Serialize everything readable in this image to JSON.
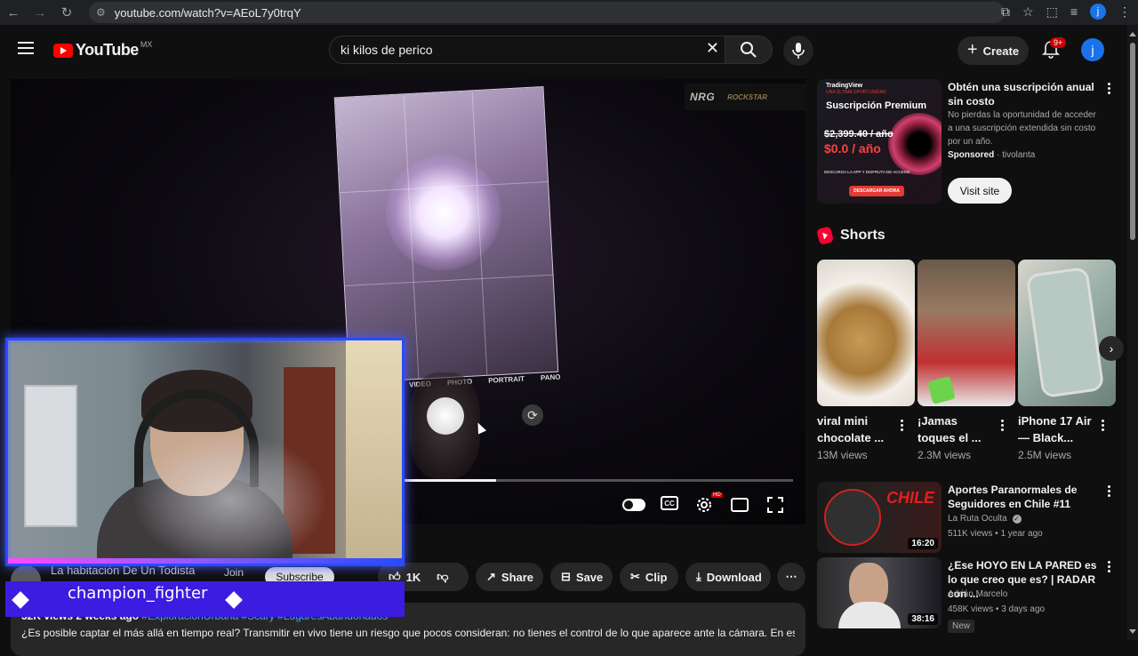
{
  "browser": {
    "url": "youtube.com/watch?v=AEoL7y0trqY",
    "profile_initial": "j"
  },
  "header": {
    "logo_text": "YouTube",
    "region": "MX",
    "search_value": "ki kilos de perico",
    "create_label": "Create",
    "notification_badge": "9+",
    "avatar_initial": "j"
  },
  "player": {
    "brand_logos": [
      "NRG",
      "ROCKSTAR"
    ],
    "camera_modes": [
      "VIDEO",
      "PHOTO",
      "PORTRAIT",
      "PANO"
    ],
    "hd_badge": "HD",
    "cc_label": "CC",
    "progress_fraction": 0.24
  },
  "stream_overlay": {
    "username": "champion_fighter"
  },
  "channel": {
    "name": "La habitación De Un Todista",
    "join_label": "Join",
    "subscribe_label": "Subscribe"
  },
  "actions": {
    "like_count": "1K",
    "share_label": "Share",
    "save_label": "Save",
    "clip_label": "Clip",
    "download_label": "Download"
  },
  "description": {
    "meta": "32K views  2 weeks ago",
    "tags": "#ExploracionUrbana #Scary #LugaresAbandonados",
    "text": "¿Es posible captar el más allá en tiempo real? Transmitir en vivo tiene un riesgo que pocos consideran: no tienes el control de lo que aparece ante la cámara. En este"
  },
  "ad": {
    "brand": "TradingView",
    "subtitle": "UNA ÚLTIMA OPORTUNIDAD",
    "title": "Suscripción Premium",
    "price_old": "$2,399.40 / año",
    "price_new": "$0.0 / año",
    "cta_text": "DESCARGA LA APP Y DISFRUTA DE ACCESO",
    "cta_button": "DESCARGAR AHORA",
    "heading": "Obtén una suscripción anual sin costo",
    "description": "No pierdas la oportunidad de acceder a una suscripción extendida sin costo por un año.",
    "sponsored_label": "Sponsored",
    "advertiser": "tivolanta",
    "visit_label": "Visit site"
  },
  "shorts": {
    "heading": "Shorts",
    "items": [
      {
        "title": "viral mini chocolate ...",
        "views": "13M views"
      },
      {
        "title": "¡Jamas toques el ...",
        "views": "2.3M views"
      },
      {
        "title": "iPhone 17 Air — Black...",
        "views": "2.5M views"
      }
    ]
  },
  "recommendations": [
    {
      "title": "Aportes Paranormales de Seguidores en Chile #11",
      "channel": "La Ruta Oculta",
      "meta": "511K views • 1 year ago",
      "duration": "16:20",
      "thumb_text": "CHILE"
    },
    {
      "title": "¿Ese HOYO EN LA PARED es lo que creo que es? | RADAR con ...",
      "channel": "Adrián Marcelo",
      "meta": "458K views • 3 days ago",
      "duration": "38:16",
      "badge": "New"
    }
  ],
  "colors": {
    "background": "#0f0f0f",
    "accent_red": "#ff0000",
    "overlay_blue": "#2a4bff",
    "link_blue": "#3ea6ff"
  }
}
